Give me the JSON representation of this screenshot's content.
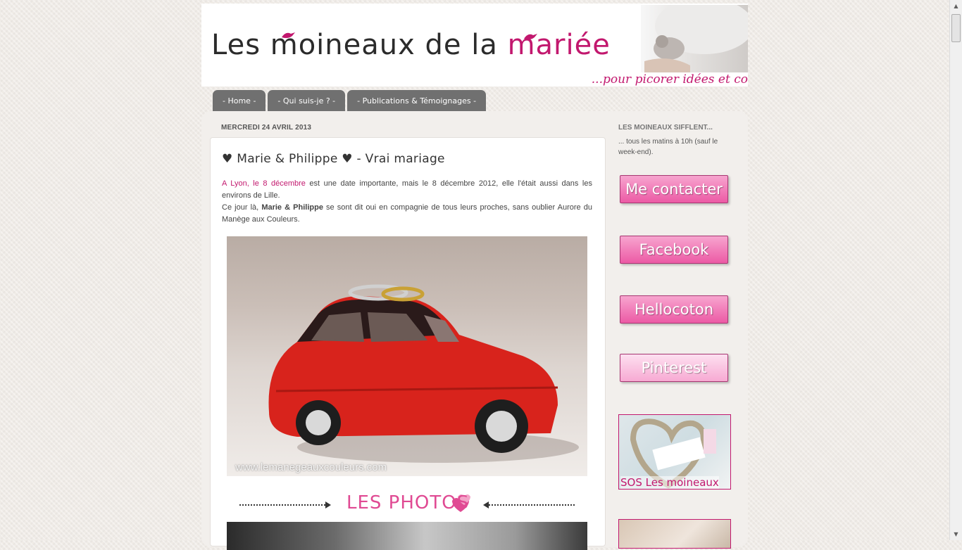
{
  "header": {
    "title_start": "Les moineaux de la ",
    "title_accent": "mariée",
    "tagline": "...pour picorer idées et co"
  },
  "nav": {
    "tabs": [
      {
        "label": "- Home -"
      },
      {
        "label": "- Qui suis-je ? -"
      },
      {
        "label": "- Publications & Témoignages -"
      }
    ]
  },
  "post": {
    "date": "MERCREDI 24 AVRIL 2013",
    "title": "♥ Marie & Philippe ♥ - Vrai mariage",
    "p1_link": "A Lyon, le 8 décembre",
    "p1_rest": " est une date importante, mais le 8 décembre 2012, elle l'était aussi dans les environs de Lille.",
    "p2_start": "Ce jour là, ",
    "p2_bold": "Marie & Philippe",
    "p2_rest": " se sont dit oui en compagnie de tous leurs proches, sans oublier Aurore du Manège aux Couleurs.",
    "photo_watermark": "www.lemanegeauxcouleurs.com",
    "section_label": "LES PHOTOS"
  },
  "sidebar": {
    "title": "LES MOINEAUX SIFFLENT...",
    "text": "... tous les matins à 10h (sauf le week-end).",
    "buttons": [
      {
        "label": "Me contacter"
      },
      {
        "label": "Facebook"
      },
      {
        "label": "Hellocoton"
      },
      {
        "label": "Pinterest"
      }
    ],
    "sos_label": "SOS Les moineaux"
  },
  "colors": {
    "accent": "#c2186e",
    "nav_bg": "#707070",
    "button_pink": "#ec5aa5"
  }
}
